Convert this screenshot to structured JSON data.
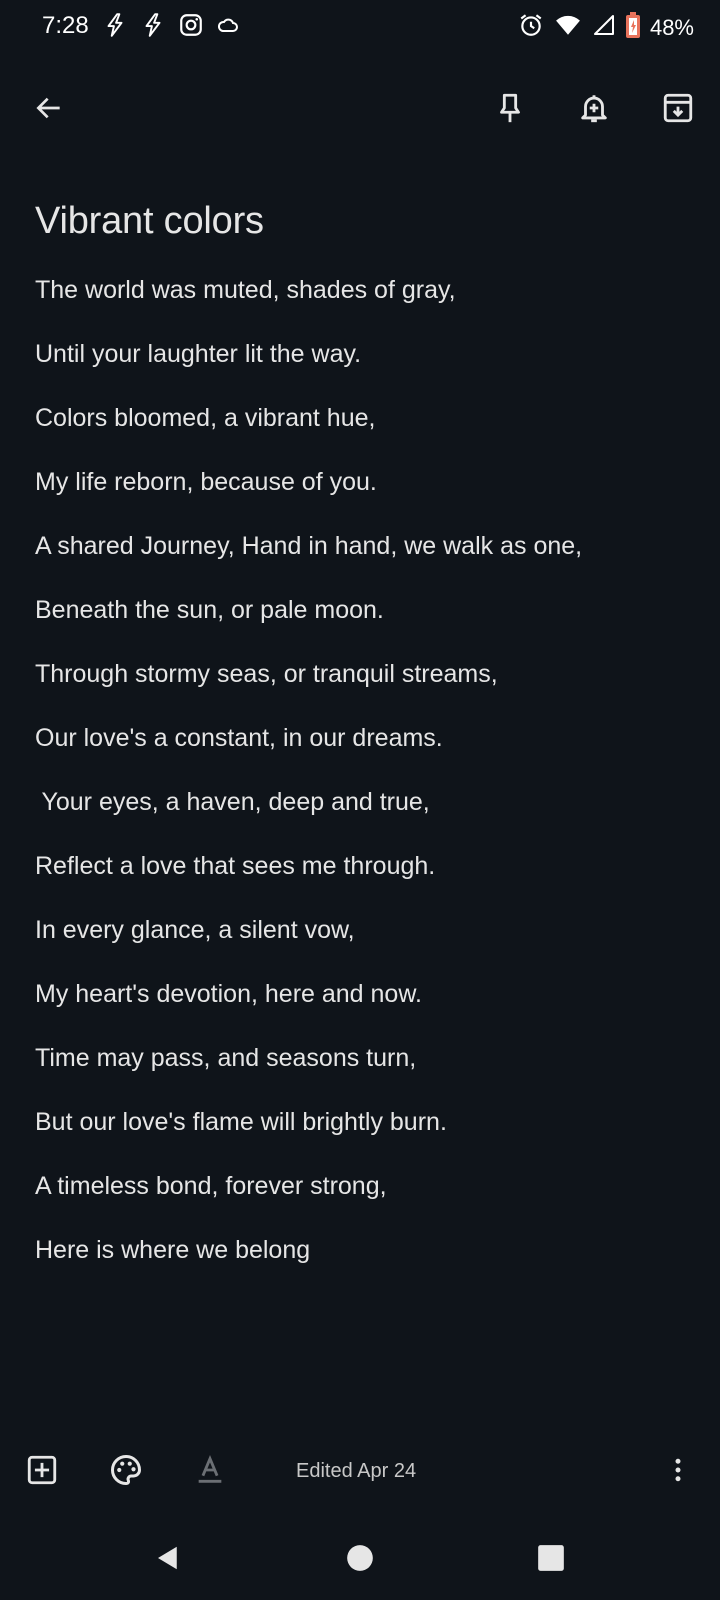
{
  "status_bar": {
    "time": "7:28",
    "left_icons": [
      "flash-icon",
      "flash-icon",
      "instagram-icon",
      "cloud-icon"
    ],
    "right_icons": [
      "alarm-icon",
      "wifi-icon",
      "signal-icon",
      "battery-icon"
    ],
    "battery": "48%"
  },
  "toolbar": {
    "back_icon": "arrow-left-icon",
    "pin_icon": "pin-icon",
    "reminder_icon": "bell-add-icon",
    "archive_icon": "archive-icon"
  },
  "note": {
    "title": "Vibrant colors",
    "lines": [
      "The world was muted, shades of gray,",
      "Until your laughter lit the way.",
      "Colors bloomed, a vibrant hue,",
      "My life reborn, because of you.",
      "A shared Journey, Hand in hand, we walk as one,",
      "Beneath the sun, or pale moon.",
      "Through stormy seas, or tranquil streams,",
      "Our love's a constant, in our dreams.",
      " Your eyes, a haven, deep and true,",
      "Reflect a love that sees me through.",
      "In every glance, a silent vow,",
      "My heart's devotion, here and now.",
      "Time may pass, and seasons turn,",
      "But our love's flame will brightly burn.",
      "A timeless bond, forever strong,",
      "Here is where we belong"
    ]
  },
  "bottom_bar": {
    "add_icon": "add-box-icon",
    "palette_icon": "palette-icon",
    "text_format_icon": "text-format-icon",
    "edited": "Edited Apr 24",
    "more_icon": "more-vert-icon"
  },
  "nav_bar": {
    "back_icon": "triangle-back-icon",
    "home_icon": "circle-home-icon",
    "recents_icon": "square-recents-icon"
  }
}
